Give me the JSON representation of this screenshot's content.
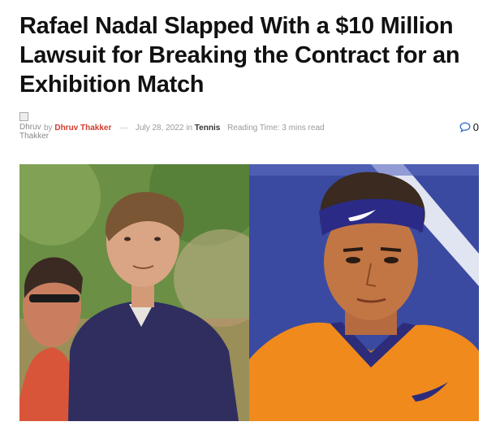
{
  "article": {
    "title": "Rafael Nadal Slapped With a $10 Million Lawsuit for Breaking the Contract for an Exhibition Match"
  },
  "meta": {
    "avatar_alt": "Dhruv Thakker",
    "by_label": "by",
    "author": "Dhruv Thakker",
    "separator": "—",
    "date": "July 28, 2022",
    "in_label": "in",
    "category": "Tennis",
    "reading_time": "Reading Time: 3 mins read",
    "comment_count": "0"
  },
  "colors": {
    "author": "#d23c2e",
    "comment_icon": "#2f6fd1"
  },
  "icons": {
    "comments": "speech-bubble-icon",
    "avatar": "broken-image-icon"
  }
}
